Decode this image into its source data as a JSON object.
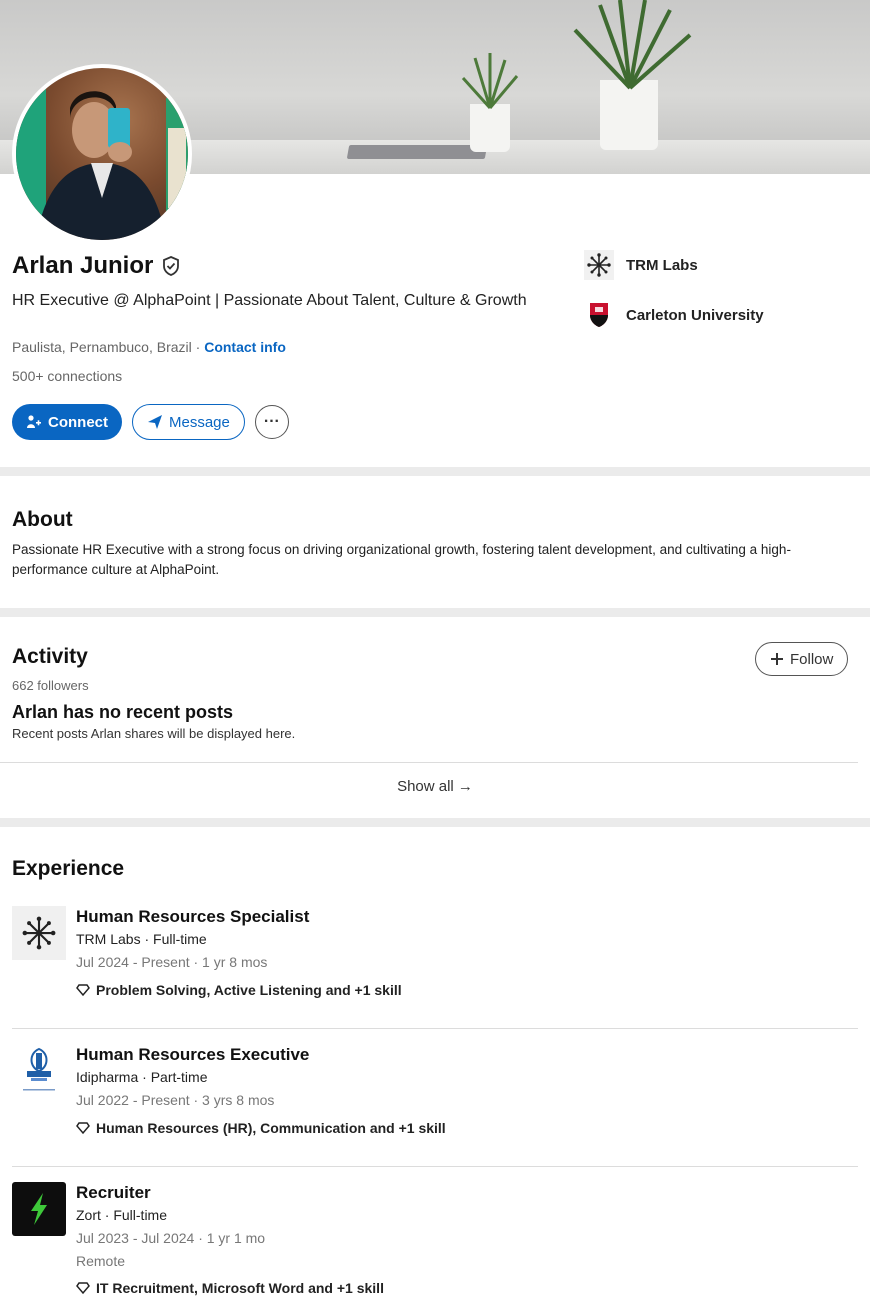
{
  "profile": {
    "name": "Arlan Junior",
    "headline": "HR Executive @ AlphaPoint | Passionate About Talent, Culture & Growth",
    "location": "Paulista, Pernambuco, Brazil",
    "location_sep": " · ",
    "contact_info": "Contact info",
    "connections": "500+ connections"
  },
  "actions": {
    "connect": "Connect",
    "message": "Message",
    "more": "···"
  },
  "sidebar": {
    "company": "TRM Labs",
    "school": "Carleton University"
  },
  "about": {
    "title": "About",
    "text": "Passionate HR Executive with a strong focus on driving organizational growth, fostering talent development, and cultivating a high-performance culture at AlphaPoint."
  },
  "activity": {
    "title": "Activity",
    "followers": "662 followers",
    "follow_label": "Follow",
    "empty_title": "Arlan has no recent posts",
    "empty_sub": "Recent posts Arlan shares will be displayed here.",
    "show_all": "Show all →"
  },
  "experience": {
    "title": "Experience",
    "items": [
      {
        "title": "Human Resources Specialist",
        "company": "TRM Labs · Full-time",
        "dates": "Jul 2024 - Present · 1 yr 8 mos",
        "location": "",
        "skills": "Problem Solving, Active Listening and +1 skill"
      },
      {
        "title": "Human Resources Executive",
        "company": "Idipharma · Part-time",
        "dates": "Jul 2022 - Present · 3 yrs 8 mos",
        "location": "",
        "skills": "Human Resources (HR), Communication and +1 skill"
      },
      {
        "title": "Recruiter",
        "company": "Zort · Full-time",
        "dates": "Jul 2023 - Jul 2024 · 1 yr 1 mo",
        "location": "Remote",
        "skills": "IT Recruitment, Microsoft Word and +1 skill"
      }
    ]
  },
  "colors": {
    "accent": "#0a66c2",
    "divider": "#ebebeb",
    "zort_bolt": "#3ec83a"
  }
}
